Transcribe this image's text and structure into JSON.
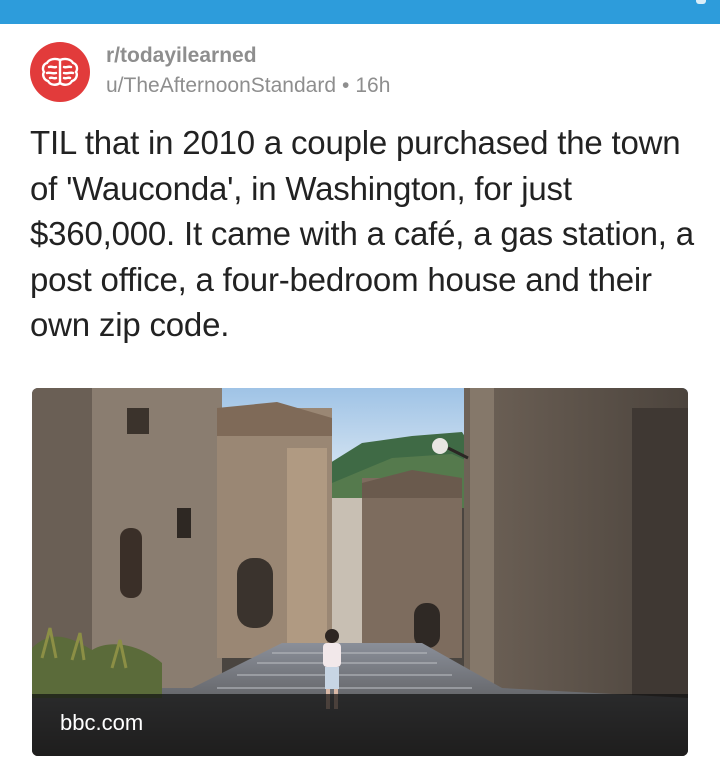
{
  "app": {
    "accent_color": "#2d9cdb",
    "icon": "reddit-subreddit-brain-icon"
  },
  "post": {
    "subreddit": "r/todayilearned",
    "author": "u/TheAfternoonStandard",
    "separator": "•",
    "age": "16h",
    "title": "TIL that in 2010 a couple purchased the town of 'Wauconda', in Washington, for just $360,000. It came with a café, a gas station, a post office, a four-bedroom house and their own zip code.",
    "link_domain": "bbc.com"
  }
}
